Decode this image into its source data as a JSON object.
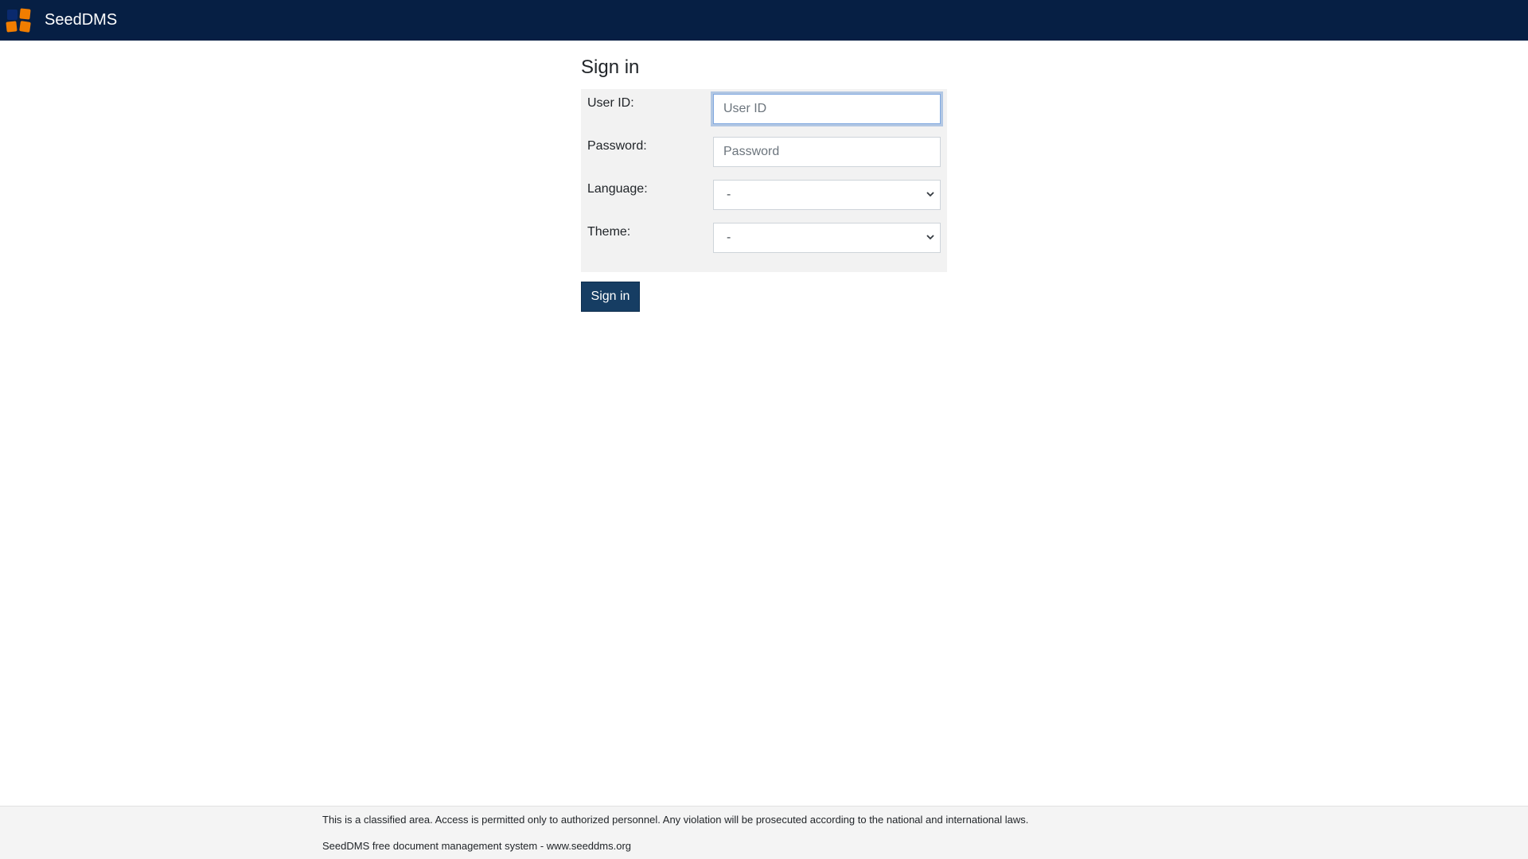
{
  "navbar": {
    "brand_name": "SeedDMS",
    "background": "#061f44",
    "logo_icon": "seeddms-logo-icon"
  },
  "login": {
    "title": "Sign in",
    "user_id": {
      "label": "User ID:",
      "placeholder": "User ID",
      "value": ""
    },
    "password": {
      "label": "Password:",
      "placeholder": "Password",
      "value": ""
    },
    "language": {
      "label": "Language:",
      "selected": "-"
    },
    "theme": {
      "label": "Theme:",
      "selected": "-"
    },
    "submit_label": "Sign in",
    "button_color": "#163d63"
  },
  "footer": {
    "disclaimer": "This is a classified area. Access is permitted only to authorized personnel. Any violation will be prosecuted according to the national and international laws.",
    "credit": "SeedDMS free document management system - www.seeddms.org"
  }
}
